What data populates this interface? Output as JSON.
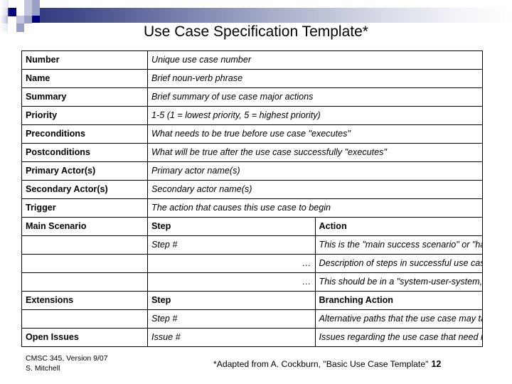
{
  "slide": {
    "title": "Use Case Specification Template*",
    "accent_color": "#000080",
    "gradient_from": "#313a7c",
    "gradient_to": "#ffffff"
  },
  "table": {
    "rows": [
      {
        "label": "Number",
        "value": "Unique use case number"
      },
      {
        "label": "Name",
        "value": "Brief noun-verb phrase"
      },
      {
        "label": "Summary",
        "value": "Brief summary of use case major actions"
      },
      {
        "label": "Priority",
        "value": "1-5 (1 = lowest priority, 5 = highest priority)"
      },
      {
        "label": "Preconditions",
        "value": "What needs to be true before use case \"executes\""
      },
      {
        "label": "Postconditions",
        "value": "What will be true after the use case successfully \"executes\""
      },
      {
        "label": "Primary Actor(s)",
        "value": "Primary actor name(s)"
      },
      {
        "label": "Secondary Actor(s)",
        "value": "Secondary actor name(s)"
      },
      {
        "label": "Trigger",
        "value": "The action that causes this use case to begin"
      }
    ],
    "main_scenario": {
      "label": "Main Scenario",
      "step_header": "Step",
      "action_header": "Action",
      "steps": [
        {
          "step": "Step #",
          "action": "This is the \"main success scenario\" or \"happy path.\""
        },
        {
          "step": "…",
          "action": "Description of steps in successful use case \"execution\""
        },
        {
          "step": "…",
          "action": "This should be in a \"system-user-system, etc.\" format."
        }
      ]
    },
    "extensions": {
      "label": "Extensions",
      "step_header": "Step",
      "action_header": "Branching Action",
      "steps": [
        {
          "step": "Step #",
          "action": "Alternative paths that the use case may take"
        }
      ]
    },
    "open_issues": {
      "label": "Open Issues",
      "step": "Issue #",
      "action": "Issues regarding the use case that need resolution"
    }
  },
  "footer": {
    "course_line1": "CMSC 345, Version 9/07",
    "course_line2": "S. Mitchell",
    "attribution": "*Adapted from A. Cockburn, \"Basic Use Case Template\"",
    "slide_number": "12"
  }
}
